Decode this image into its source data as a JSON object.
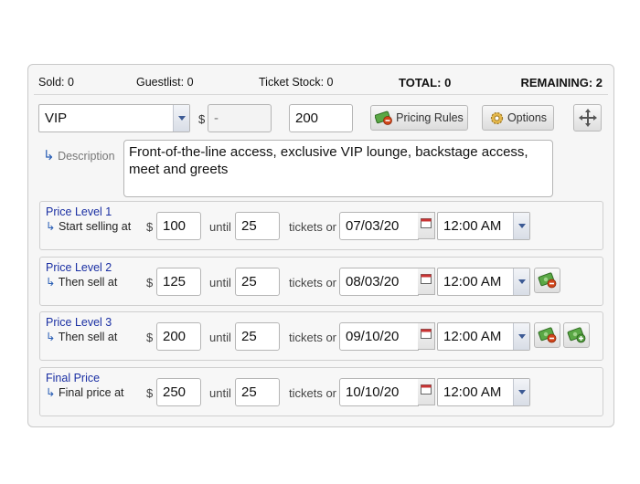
{
  "stats": {
    "sold": "Sold: 0",
    "guestlist": "Guestlist: 0",
    "ticket_stock": "Ticket Stock: 0",
    "total": "TOTAL: 0",
    "remaining": "REMAINING: 2"
  },
  "ticket": {
    "type_selected": "VIP",
    "currency": "$",
    "price_placeholder": "-",
    "quantity": "200",
    "pricing_rules_label": "Pricing Rules",
    "options_label": "Options"
  },
  "description": {
    "label": "Description",
    "arrow": "↳",
    "text": "Front-of-the-line access, exclusive VIP lounge, backstage access, meet and greets"
  },
  "labels": {
    "currency": "$",
    "until": "until",
    "tickets_or": "tickets or"
  },
  "price_levels": [
    {
      "title": "Price Level 1",
      "sub": "Start selling at",
      "price": "100",
      "until": "25",
      "date": "07/03/20",
      "time": "12:00 AM"
    },
    {
      "title": "Price Level 2",
      "sub": "Then sell at",
      "price": "125",
      "until": "25",
      "date": "08/03/20",
      "time": "12:00 AM"
    },
    {
      "title": "Price Level 3",
      "sub": "Then sell at",
      "price": "200",
      "until": "25",
      "date": "09/10/20",
      "time": "12:00 AM"
    },
    {
      "title": "Final Price",
      "sub": "Final price at",
      "price": "250",
      "until": "25",
      "date": "10/10/20",
      "time": "12:00 AM"
    }
  ],
  "icons": {
    "money_delete": "money-delete-icon",
    "money_add": "money-add-icon",
    "gear": "gear-icon",
    "move": "move-arrows-icon",
    "calendar": "calendar-icon"
  },
  "colors": {
    "link_blue": "#1a2fa3",
    "arrow_blue": "#2b5fb5",
    "money_green": "#4e9a3a",
    "delete_red": "#d0451b"
  }
}
